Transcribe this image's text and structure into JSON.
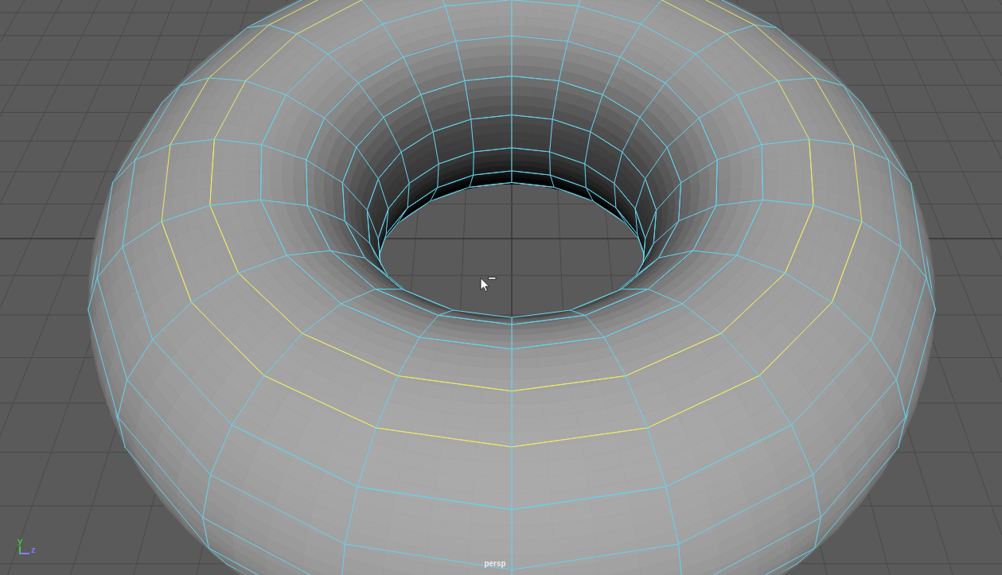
{
  "viewport": {
    "camera_label": "persp",
    "axes": [
      {
        "label": "y",
        "color": "#3fcc3f",
        "kind": "vertical"
      },
      {
        "label": "z",
        "color": "#8080ff",
        "kind": "horizontal"
      }
    ]
  }
}
